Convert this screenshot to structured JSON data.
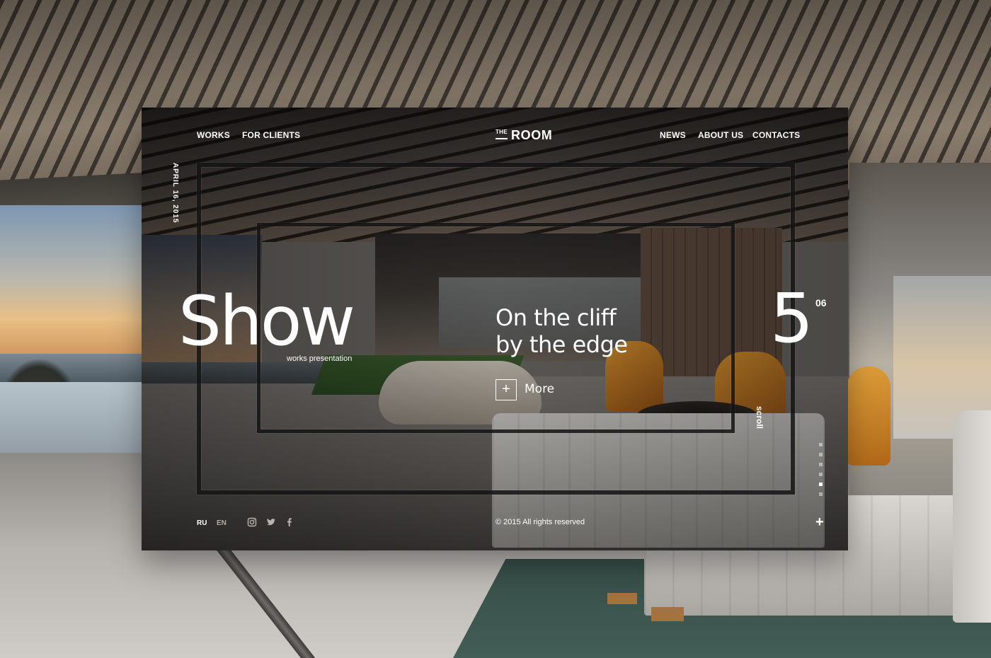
{
  "nav": {
    "left": [
      "WORKS",
      "FOR CLIENTS"
    ],
    "right": [
      "NEWS",
      "ABOUT US",
      "CONTACTS"
    ]
  },
  "logo": {
    "prefix": "THE",
    "name": "ROOM"
  },
  "date": "APRIL 16, 2015",
  "hero": {
    "title": "Show",
    "subtitle": "works presentation"
  },
  "slide": {
    "headline_line1": "On the cliff",
    "headline_line2": "by the edge",
    "more_label": "More",
    "more_icon": "+",
    "number": "5",
    "total": "06",
    "scroll_label": "scroll",
    "dots": 6,
    "active_dot": 5
  },
  "footer": {
    "languages": [
      "RU",
      "EN"
    ],
    "active_language": "RU",
    "social_icons": [
      "instagram-icon",
      "twitter-icon",
      "facebook-icon"
    ],
    "copyright": "© 2015   All rights reserved",
    "plus_icon": "+"
  },
  "colors": {
    "text": "#ffffff",
    "inactive_lang": "#b5ac9f",
    "frame": "#141414"
  }
}
